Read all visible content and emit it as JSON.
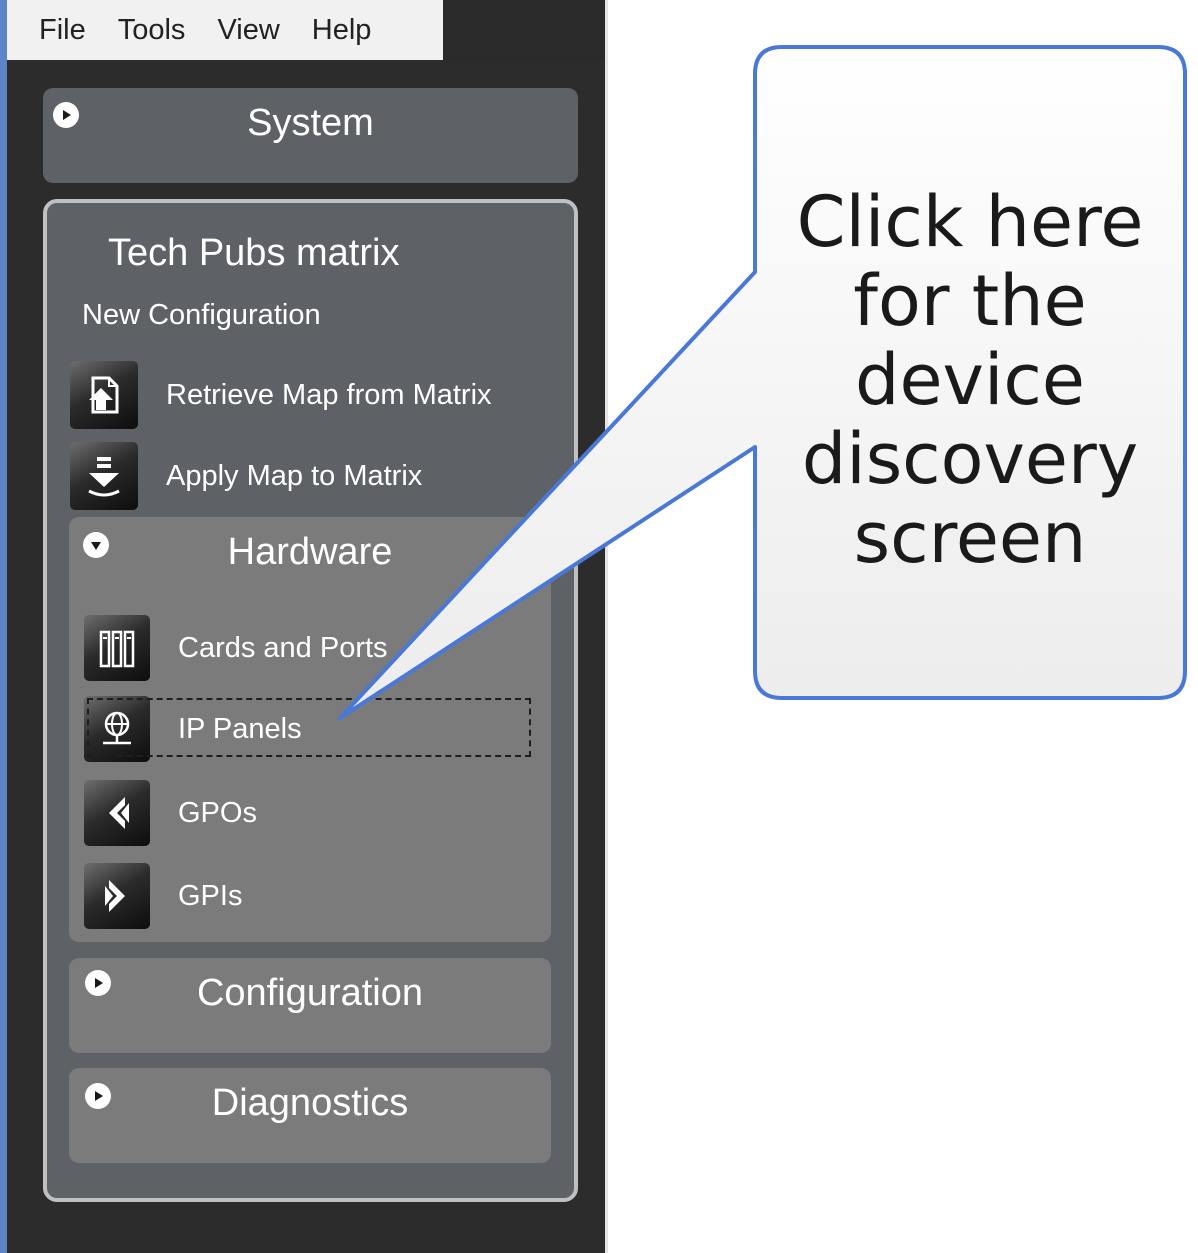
{
  "menubar": {
    "items": [
      "File",
      "Tools",
      "View",
      "Help"
    ]
  },
  "sidebar": {
    "system": {
      "title": "System",
      "icon": "play-circle-icon"
    },
    "matrix": {
      "title": "Tech Pubs matrix",
      "subtitle": "New Configuration",
      "actions": [
        {
          "label": "Retrieve Map from Matrix",
          "icon": "retrieve-map-icon"
        },
        {
          "label": "Apply Map to Matrix",
          "icon": "apply-map-icon"
        }
      ]
    },
    "hardware": {
      "title": "Hardware",
      "icon": "expanded-circle-icon",
      "items": [
        {
          "label": "Cards and Ports",
          "icon": "cards-ports-icon"
        },
        {
          "label": "IP Panels",
          "icon": "globe-icon",
          "focused": true
        },
        {
          "label": "GPOs",
          "icon": "gpo-arrow-icon"
        },
        {
          "label": "GPIs",
          "icon": "gpi-arrow-icon"
        }
      ]
    },
    "configuration": {
      "title": "Configuration"
    },
    "diagnostics": {
      "title": "Diagnostics"
    }
  },
  "callout": {
    "lines": [
      "Click here",
      "for the",
      "device",
      "discovery",
      "screen"
    ],
    "border_color": "#4a78d6"
  },
  "colors": {
    "pane_bg": "#2c2c2c",
    "section_bg": "#5e6165",
    "subsection_bg": "#7b7b7b",
    "accent": "#5a86c8"
  }
}
